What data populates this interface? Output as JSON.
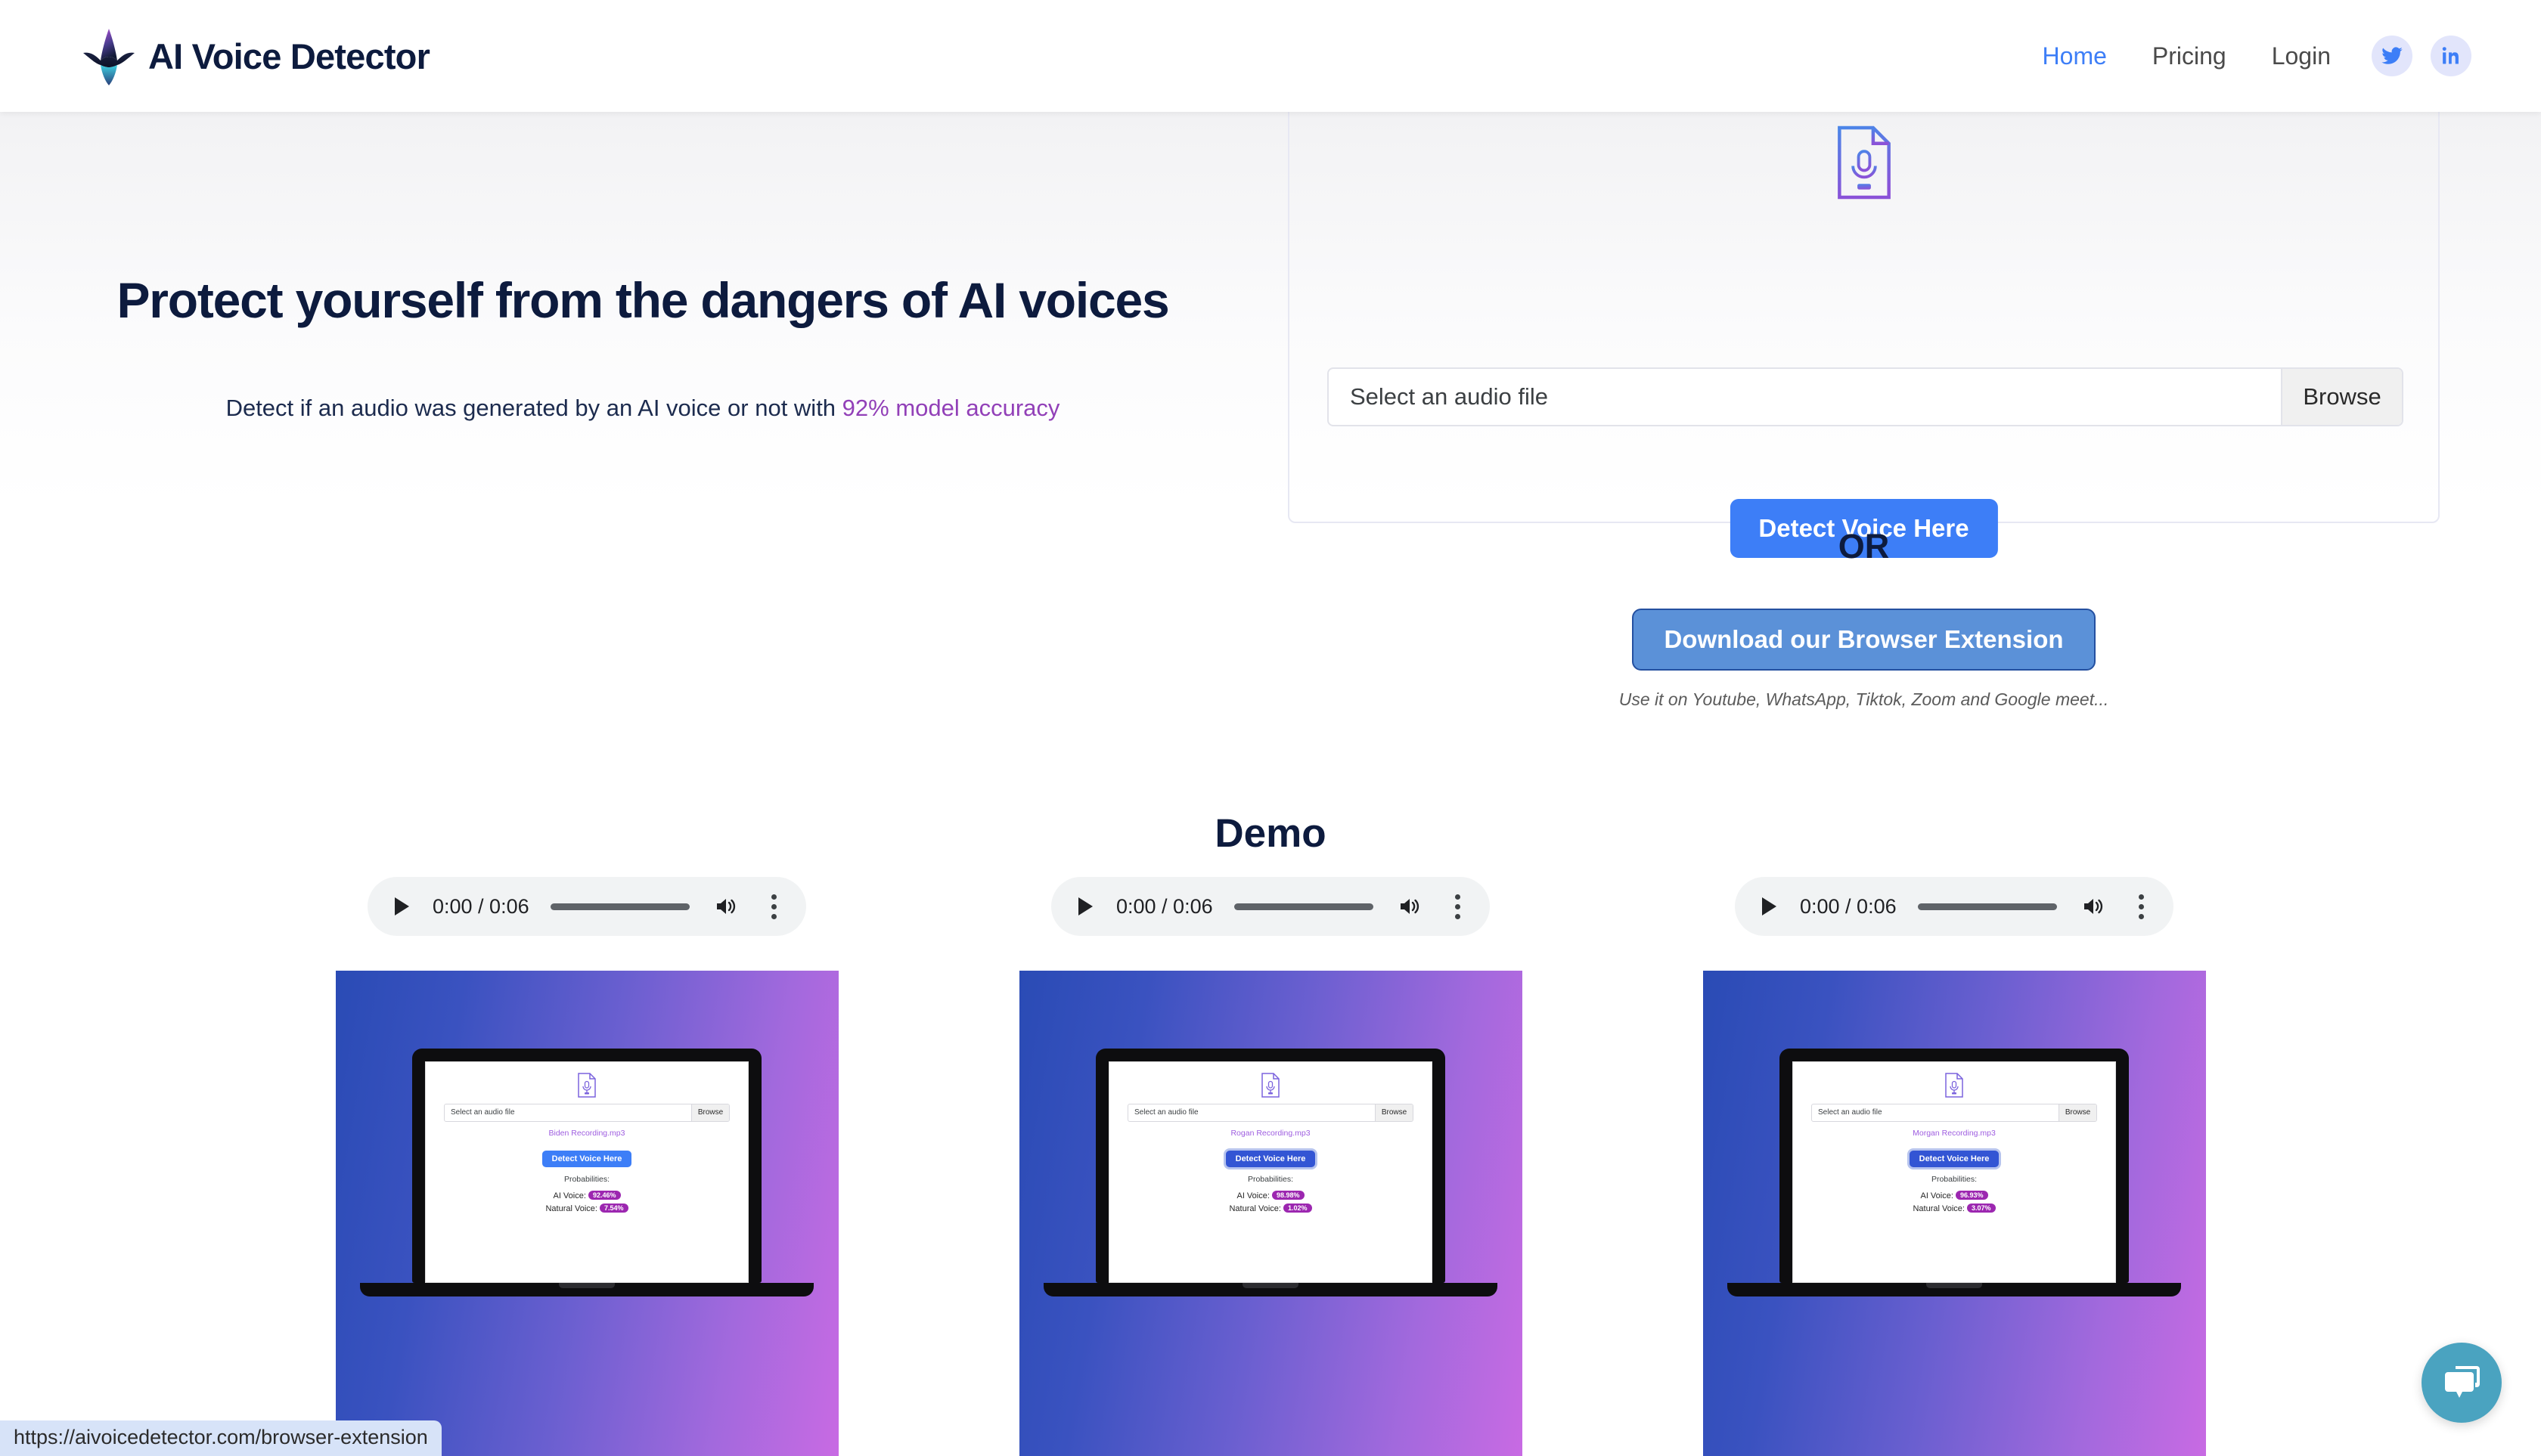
{
  "header": {
    "brand": "AI Voice Detector",
    "brand_icon": "waveform-logo-icon",
    "nav": [
      {
        "label": "Home",
        "active": true
      },
      {
        "label": "Pricing",
        "active": false
      },
      {
        "label": "Login",
        "active": false
      }
    ],
    "social": [
      {
        "name": "twitter-icon",
        "label": "Twitter"
      },
      {
        "name": "linkedin-icon",
        "label": "LinkedIn"
      }
    ]
  },
  "hero": {
    "title": "Protect yourself from the dangers of AI voices",
    "subtitle_lead": "Detect if an audio was generated by an AI voice or not with ",
    "subtitle_accent": "92% model accuracy",
    "accent_color": "#9240b8"
  },
  "upload": {
    "doc_icon": "audio-document-icon",
    "file_placeholder": "Select an audio file",
    "browse_label": "Browse",
    "detect_label": "Detect Voice Here",
    "detect_color": "#3d7ef7"
  },
  "extension": {
    "or_label": "OR",
    "button_label": "Download our Browser Extension",
    "note": "Use it on Youtube, WhatsApp, Tiktok, Zoom and Google meet...",
    "button_color": "#5b91d8"
  },
  "demo": {
    "title": "Demo",
    "cards": [
      {
        "player": {
          "current_time": "0:00",
          "duration": "0:06",
          "time_display": "0:00 / 0:06"
        },
        "mini": {
          "file_placeholder": "Select an audio file",
          "browse_label": "Browse",
          "file_name": "Biden Recording.mp3",
          "detect_label": "Detect Voice Here",
          "detect_focused": false,
          "probabilities_label": "Probabilities:",
          "ai_label": "AI Voice:",
          "ai_value": "92.46%",
          "natural_label": "Natural Voice:",
          "natural_value": "7.54%"
        }
      },
      {
        "player": {
          "current_time": "0:00",
          "duration": "0:06",
          "time_display": "0:00 / 0:06"
        },
        "mini": {
          "file_placeholder": "Select an audio file",
          "browse_label": "Browse",
          "file_name": "Rogan Recording.mp3",
          "detect_label": "Detect Voice Here",
          "detect_focused": true,
          "probabilities_label": "Probabilities:",
          "ai_label": "AI Voice:",
          "ai_value": "98.98%",
          "natural_label": "Natural Voice:",
          "natural_value": "1.02%"
        }
      },
      {
        "player": {
          "current_time": "0:00",
          "duration": "0:06",
          "time_display": "0:00 / 0:06"
        },
        "mini": {
          "file_placeholder": "Select an audio file",
          "browse_label": "Browse",
          "file_name": "Morgan Recording.mp3",
          "detect_label": "Detect Voice Here",
          "detect_focused": true,
          "probabilities_label": "Probabilities:",
          "ai_label": "AI Voice:",
          "ai_value": "96.93%",
          "natural_label": "Natural Voice:",
          "natural_value": "3.07%"
        }
      }
    ]
  },
  "chat": {
    "icon": "chat-bubble-icon",
    "color": "#4aa3c0"
  },
  "status_bar": {
    "url": "https://aivoicedetector.com/browser-extension"
  }
}
